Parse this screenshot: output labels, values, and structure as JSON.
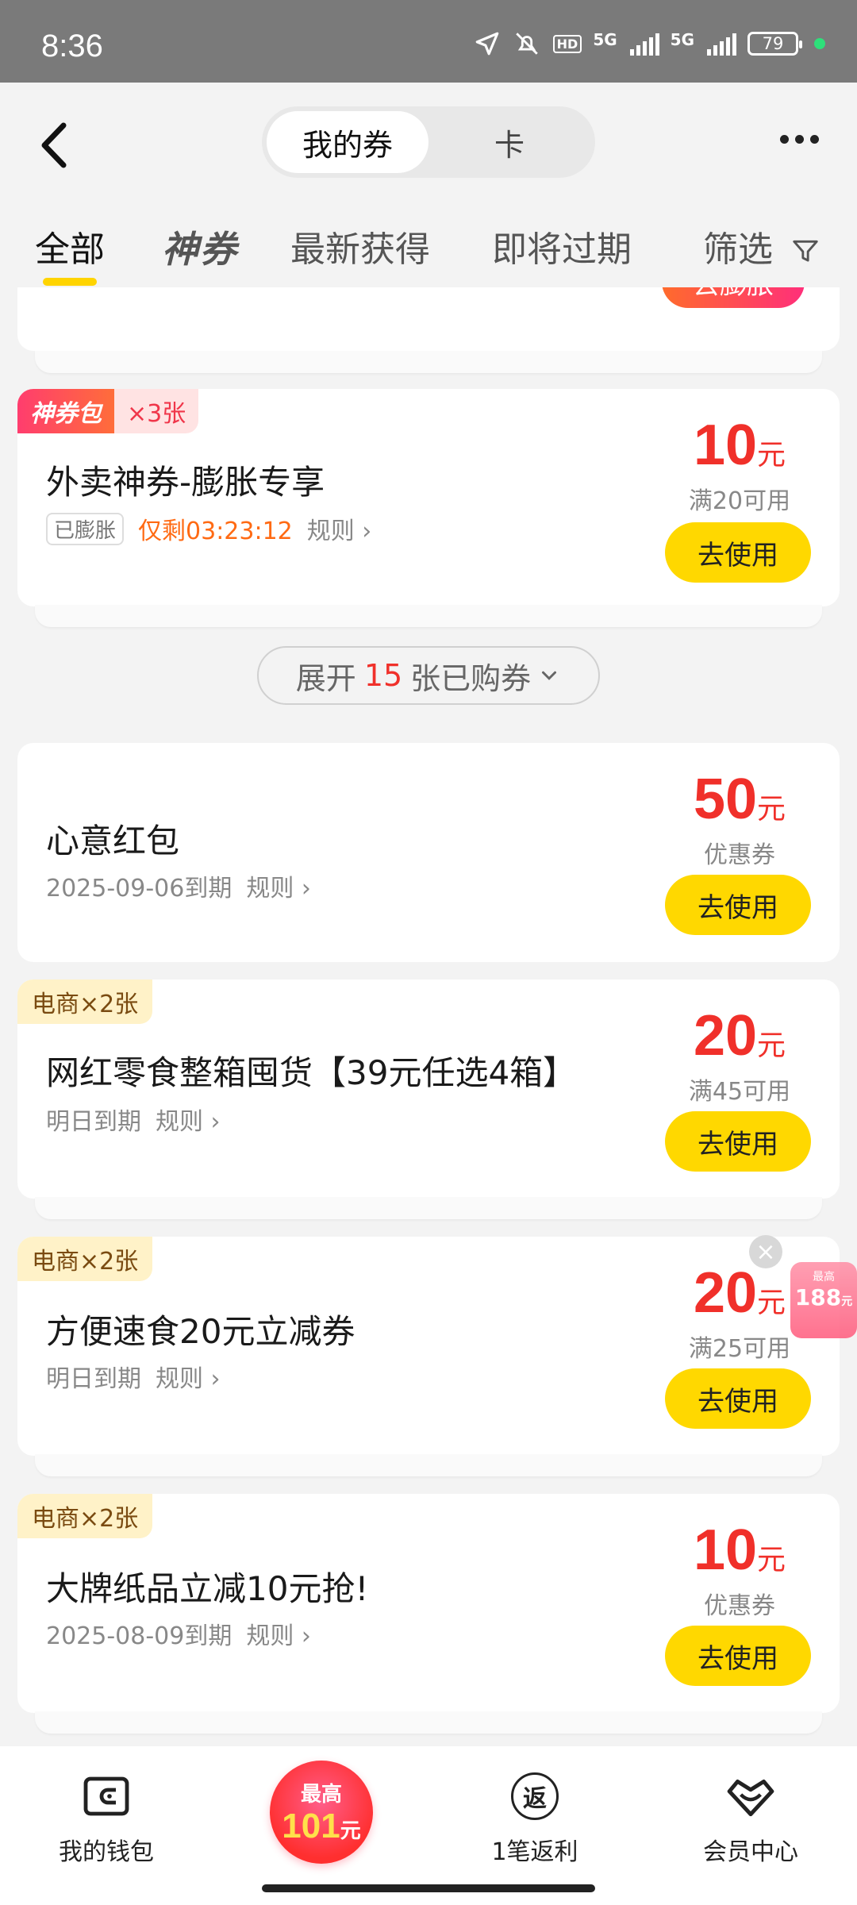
{
  "status_bar": {
    "time": "8:36",
    "battery": "79",
    "net1": "5G",
    "net2": "5G",
    "hd": "HD"
  },
  "header": {
    "segments": [
      "我的券",
      "卡"
    ],
    "filters": [
      "全部",
      "神券",
      "最新获得",
      "即将过期",
      "筛选"
    ]
  },
  "top_card": {
    "button": "去膨胀"
  },
  "cards": [
    {
      "tag": "神券包",
      "tag_count": "×3张",
      "title": "外卖神券-膨胀专享",
      "chip": "已膨胀",
      "countdown": "仅剩03:23:12",
      "rule": "规则",
      "amount": "10",
      "unit": "元",
      "condition": "满20可用",
      "button": "去使用"
    },
    {
      "title": "心意红包",
      "expiry": "2025-09-06到期",
      "rule": "规则",
      "amount": "50",
      "unit": "元",
      "condition": "优惠券",
      "button": "去使用"
    },
    {
      "tag": "电商×2张",
      "title": "网红零食整箱囤货【39元任选4箱】",
      "expiry": "明日到期",
      "rule": "规则",
      "amount": "20",
      "unit": "元",
      "condition": "满45可用",
      "button": "去使用"
    },
    {
      "tag": "电商×2张",
      "title": "方便速食20元立减券",
      "expiry": "明日到期",
      "rule": "规则",
      "amount": "20",
      "unit": "元",
      "condition": "满25可用",
      "button": "去使用"
    },
    {
      "tag": "电商×2张",
      "title": "大牌纸品立减10元抢!",
      "expiry": "2025-08-09到期",
      "rule": "规则",
      "amount": "10",
      "unit": "元",
      "condition": "优惠券",
      "button": "去使用"
    }
  ],
  "expand": {
    "prefix": "展开",
    "count": "15",
    "suffix": "张已购券"
  },
  "float_ad": {
    "small": "最高",
    "big": "188",
    "unit": "元"
  },
  "bottom_nav": {
    "wallet": "我的钱包",
    "promo_top": "最高",
    "promo_num": "101",
    "promo_unit": "元",
    "rebate": "1笔返利",
    "rebate_icon": "返",
    "member": "会员中心"
  },
  "colors": {
    "accent_yellow": "#ffd800",
    "price_red": "#f0302a",
    "countdown_orange": "#ff6a13"
  }
}
